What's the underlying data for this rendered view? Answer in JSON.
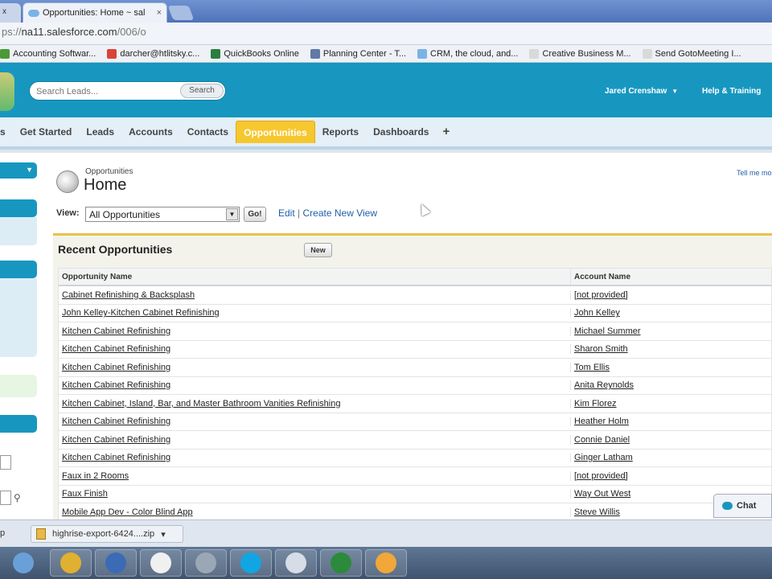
{
  "browser": {
    "tab_stub_label": "x",
    "tab_title": "Opportunities: Home ~ sal",
    "tab_close": "×",
    "url_prefix": "ps://",
    "url_host": "na11.salesforce.com",
    "url_path": "/006/o",
    "bookmarks": [
      {
        "label": "Accounting Softwar...",
        "icon": "green-doc-icon",
        "color": "#4a9a3a"
      },
      {
        "label": "darcher@htlitsky.c...",
        "icon": "gmail-icon",
        "color": "#d8443a"
      },
      {
        "label": "QuickBooks Online",
        "icon": "quickbooks-icon",
        "color": "#2a7f3e"
      },
      {
        "label": "Planning Center - T...",
        "icon": "calendar-icon",
        "color": "#5f7aa6"
      },
      {
        "label": "CRM, the cloud, and...",
        "icon": "cloud-icon",
        "color": "#7bb3e6"
      },
      {
        "label": "Creative Business M...",
        "icon": "page-icon",
        "color": "#d9d9d9"
      },
      {
        "label": "Send GotoMeeting I...",
        "icon": "page-icon",
        "color": "#d9d9d9"
      }
    ]
  },
  "header": {
    "search_placeholder": "Search Leads...",
    "search_button": "Search",
    "user_name": "Jared Crenshaw",
    "help_link": "Help & Training"
  },
  "nav": {
    "items": [
      "s",
      "Get Started",
      "Leads",
      "Accounts",
      "Contacts",
      "Opportunities",
      "Reports",
      "Dashboards"
    ],
    "active": "Opportunities",
    "plus": "+"
  },
  "page": {
    "breadcrumb": "Opportunities",
    "title": "Home",
    "tell_me": "Tell me mo",
    "view_label": "View:",
    "view_selected": "All Opportunities",
    "go_button": "Go!",
    "edit_link": "Edit",
    "create_link": "Create New View",
    "link_separator": "|"
  },
  "recent": {
    "title": "Recent Opportunities",
    "new_button": "New",
    "columns": [
      "Opportunity Name",
      "Account Name"
    ],
    "rows": [
      {
        "name": "Cabinet Refinishing & Backsplash",
        "account": "[not provided]"
      },
      {
        "name": "John Kelley-Kitchen Cabinet Refinishing",
        "account": "John Kelley"
      },
      {
        "name": "Kitchen Cabinet Refinishing",
        "account": "Michael Summer"
      },
      {
        "name": "Kitchen Cabinet Refinishing",
        "account": "Sharon Smith"
      },
      {
        "name": "Kitchen Cabinet Refinishing",
        "account": "Tom Ellis"
      },
      {
        "name": "Kitchen Cabinet Refinishing",
        "account": "Anita Reynolds"
      },
      {
        "name": "Kitchen Cabinet, Island, Bar, and Master Bathroom Vanities Refinishing",
        "account": "Kim Florez"
      },
      {
        "name": "Kitchen Cabinet Refinishing",
        "account": "Heather Holm"
      },
      {
        "name": "Kitchen Cabinet Refinishing",
        "account": "Connie Daniel"
      },
      {
        "name": "Kitchen Cabinet Refinishing",
        "account": "Ginger Latham"
      },
      {
        "name": "Faux in 2 Rooms",
        "account": "[not provided]"
      },
      {
        "name": "Faux Finish",
        "account": "Way Out West"
      },
      {
        "name": "Mobile App Dev - Color Blind App",
        "account": "Steve Willis"
      }
    ]
  },
  "chat": {
    "label": "Chat"
  },
  "downloads": {
    "stub": "p",
    "file": "highrise-export-6424....zip",
    "caret": "▾"
  },
  "taskbar": {
    "apps": [
      {
        "name": "windows-start-icon",
        "color": "#6aa0d8"
      },
      {
        "name": "chrome-icon",
        "color": "#e0b030"
      },
      {
        "name": "outlook-icon",
        "color": "#3b6bb5"
      },
      {
        "name": "clock-icon",
        "color": "#f0f0f0"
      },
      {
        "name": "network-icon",
        "color": "#9aa7b5"
      },
      {
        "name": "skype-icon",
        "color": "#12a5e4"
      },
      {
        "name": "notepad-icon",
        "color": "#d6dde6"
      },
      {
        "name": "excel-icon",
        "color": "#2c8a3c"
      },
      {
        "name": "flower-app-icon",
        "color": "#f1a73a"
      }
    ]
  },
  "colors": {
    "brand": "#1797c0",
    "active_tab": "#f7c72f",
    "link": "#1f5fa8"
  }
}
